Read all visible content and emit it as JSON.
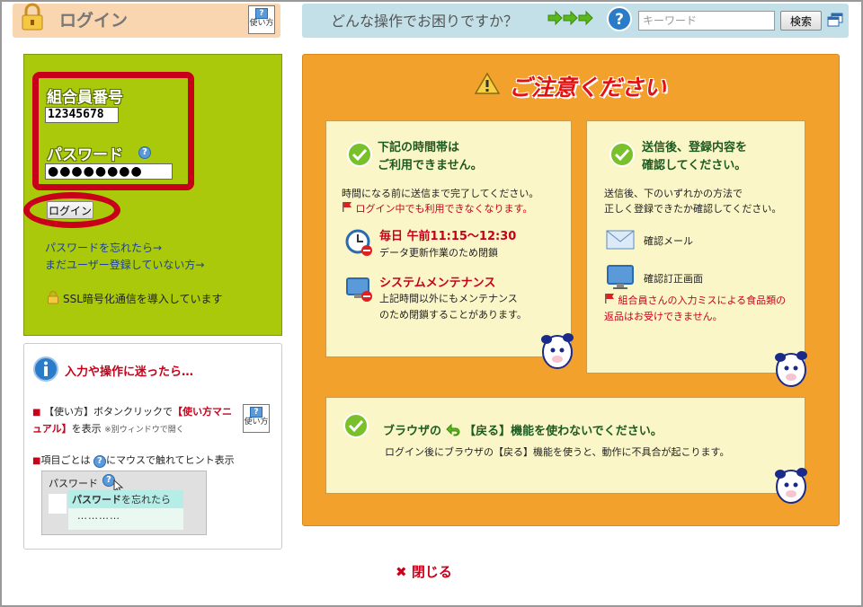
{
  "header": {
    "login_title": "ログイン",
    "manual_label": "使い方",
    "help_question": "どんな操作でお困りですか？",
    "keyword_placeholder": "キーワード",
    "search_label": "検索"
  },
  "login": {
    "member_label": "組合員番号",
    "member_value": "12345678",
    "password_label": "パスワード",
    "password_value": "●●●●●●●●",
    "login_button": "ログイン",
    "forgot_password_link": "パスワードを忘れたら→",
    "not_registered_link": "まだユーザー登録していない方→",
    "ssl_text": "SSL暗号化通信を導入しています"
  },
  "help": {
    "title": "入力や操作に迷ったら…",
    "bullet1_a": "【使い方】ボタンクリックで",
    "bullet1_hl": "【使い方マニュアル】",
    "bullet1_b": "を表示",
    "bullet1_small": "※別ウィンドウで開く",
    "bullet2_a": "項目ごとは",
    "bullet2_b": "にマウスで触れてヒント表示",
    "hint_label": "パスワード",
    "hint_popup_bold": "パスワード",
    "hint_popup_rest": "を忘れたら",
    "hint_dots": "…………"
  },
  "notice": {
    "title": "ご注意ください",
    "card1": {
      "title_line1": "下記の時間帯は",
      "title_line2": "ご利用できません。",
      "text1": "時間になる前に送信まで完了してください。",
      "text2": "ログイン中でも利用できなくなります。",
      "daily_title": "毎日 午前11:15～12:30",
      "daily_text": "データ更新作業のため閉鎖",
      "maint_title": "システムメンテナンス",
      "maint_text1": "上記時間以外にもメンテナンス",
      "maint_text2": "のため閉鎖することがあります。"
    },
    "card2": {
      "title_line1": "送信後、登録内容を",
      "title_line2": "確認してください。",
      "text1": "送信後、下のいずれかの方法で",
      "text2": "正しく登録できたか確認してください。",
      "mail_label": "確認メール",
      "screen_label": "確認訂正画面",
      "warning": "組合員さんの入力ミスによる食品類の返品はお受けできません。"
    },
    "card3": {
      "title_a": "ブラウザの",
      "title_b": "【戻る】機能を使わないでください。",
      "text": "ログイン後にブラウザの【戻る】機能を使うと、動作に不具合が起こります。"
    }
  },
  "close_label": "閉じる",
  "colors": {
    "login_panel": "#a9c90a",
    "orange_panel": "#f2a12d",
    "card_bg": "#fbf6c8",
    "accent_red": "#c8001a",
    "title_green": "#1e5a20"
  }
}
